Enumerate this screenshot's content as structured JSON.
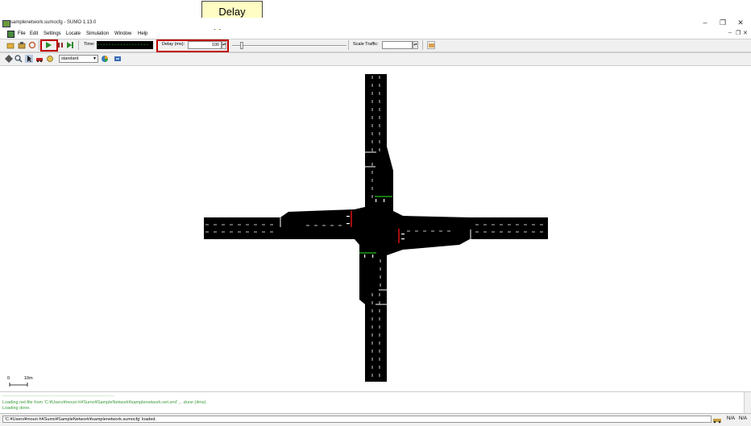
{
  "window": {
    "title": "samplenetwork.sumocfg - SUMO 1.13.0",
    "controls": [
      "–",
      "❐",
      "✕"
    ],
    "mdi_controls": [
      "–",
      "❐",
      "✕"
    ]
  },
  "menu": {
    "items": [
      "File",
      "Edit",
      "Settings",
      "Locate",
      "Simulation",
      "Window",
      "Help"
    ]
  },
  "toolbar": {
    "time_label": "Time:",
    "time_value": "------------------",
    "delay_label": "Delay (ms):",
    "delay_value": "100",
    "scale_label": "Scale Traffic:",
    "scale_value": "",
    "scheme_value": "standard"
  },
  "callout": {
    "text": "Delay"
  },
  "scale": {
    "zero": "0",
    "ten": "10m"
  },
  "log": {
    "separator": "--------------------------------------------------------------------------------------------------------",
    "lines": [
      "Loading net-file from 'C:¥Users¥mouri-h¥Sumo¥SampleNetwork¥samplenetwork.net.xml' ... done (4ms).",
      "Loading done."
    ]
  },
  "status": {
    "text": "'C:¥Users¥mouri-h¥Sumo¥SampleNetwork¥samplenetwork.sumocfg' loaded.",
    "na1": "N/A",
    "na2": "N/A"
  },
  "colors": {
    "accent_red": "#c00000",
    "log_green": "#3a9c3a",
    "road": "#000000",
    "signal_red": "#d01010",
    "signal_green": "#1aa01a"
  }
}
